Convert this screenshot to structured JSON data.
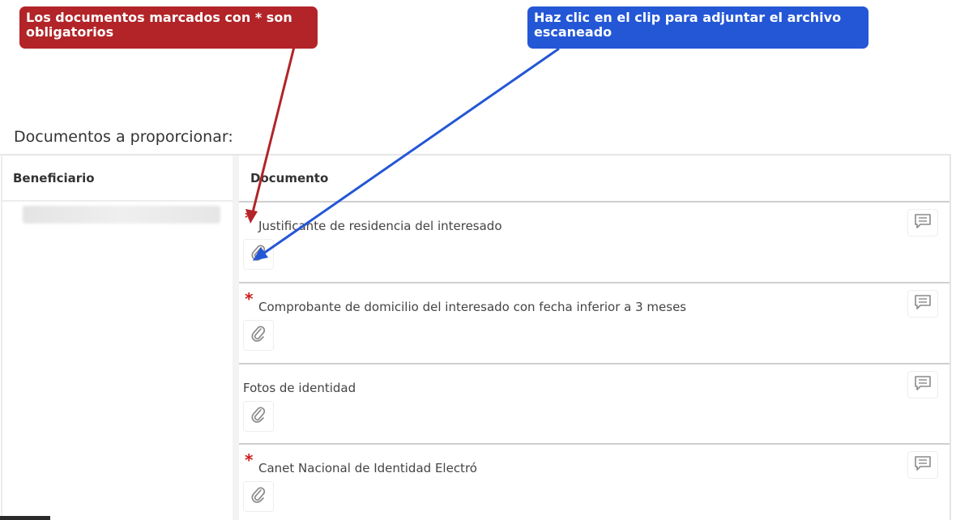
{
  "annotations": {
    "required_note": "Los documentos marcados con * son obligatorios",
    "clip_hint": "Haz clic en el clip para adjuntar el archivo escaneado",
    "colors": {
      "red": "#b22428",
      "blue": "#2457d6"
    }
  },
  "section": {
    "title": "Documentos a proporcionar:"
  },
  "table": {
    "headers": {
      "beneficiary": "Beneficiario",
      "document": "Documento"
    },
    "documents": [
      {
        "label": "Justificante de residencia del interesado",
        "required": true,
        "icons": [
          "paperclip-icon",
          "comment-icon"
        ]
      },
      {
        "label": "Comprobante de domicilio del interesado con fecha inferior a 3 meses",
        "required": true,
        "icons": [
          "paperclip-icon",
          "comment-icon"
        ]
      },
      {
        "label": "Fotos de identidad",
        "required": false,
        "icons": [
          "paperclip-icon",
          "comment-icon"
        ]
      },
      {
        "label": "Canet Nacional de Identidad Electró",
        "required": true,
        "icons": [
          "paperclip-icon",
          "comment-icon"
        ]
      }
    ],
    "required_marker": "*"
  }
}
